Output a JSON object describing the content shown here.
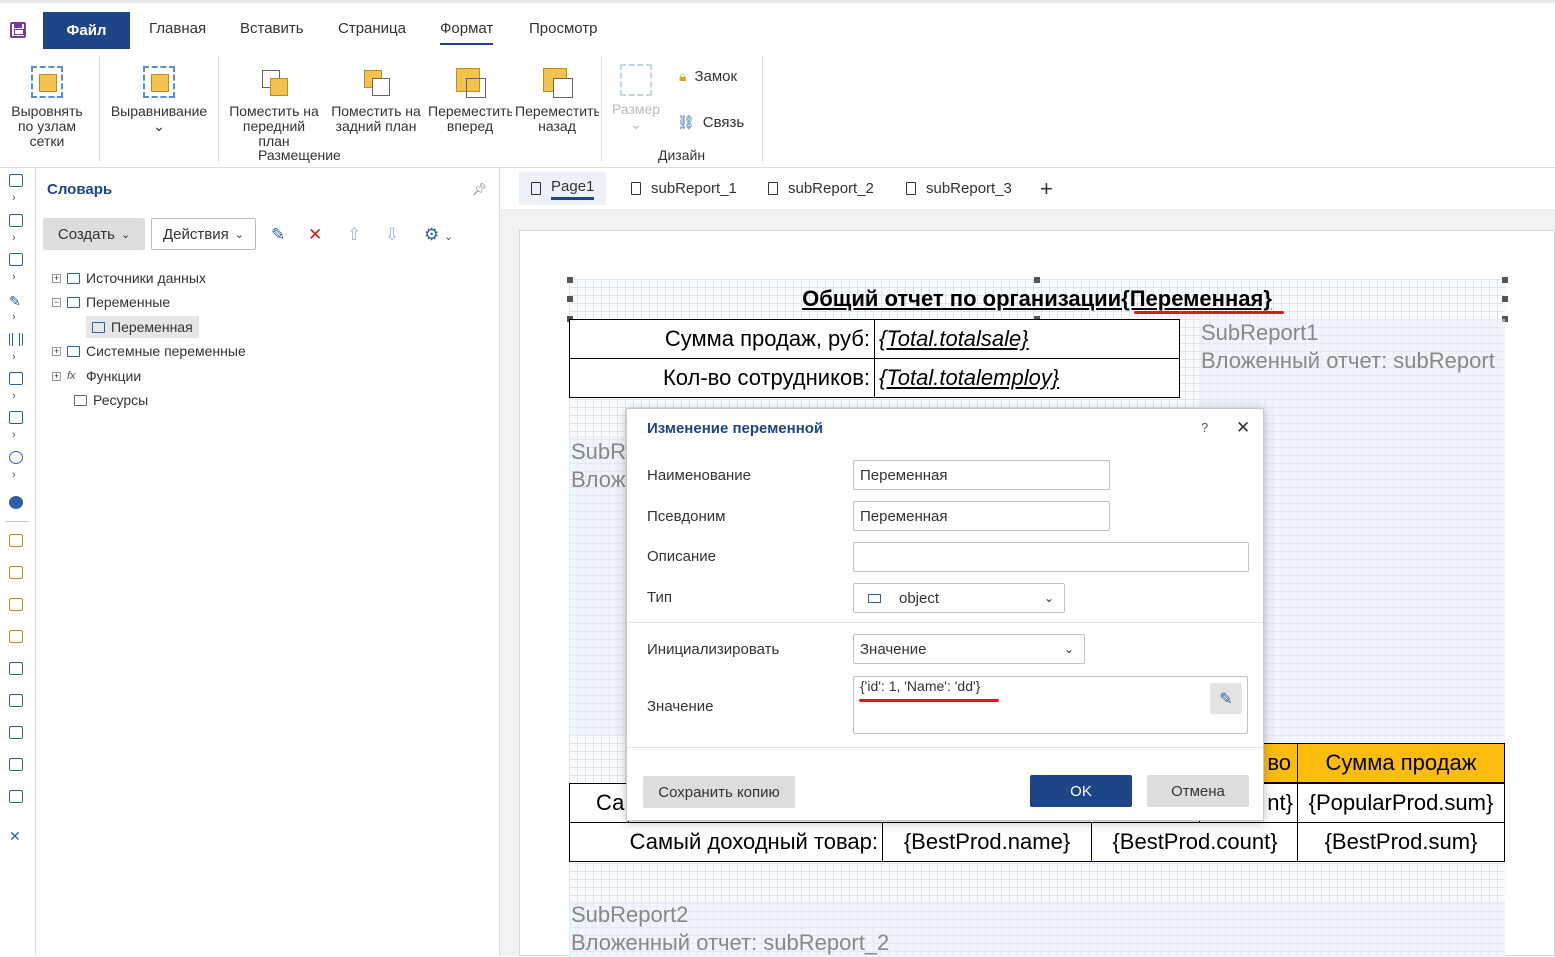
{
  "ribbon": {
    "file_tab": "Файл",
    "tabs": [
      "Главная",
      "Вставить",
      "Страница",
      "Формат",
      "Просмотр"
    ],
    "active_tab": "Формат",
    "buttons": {
      "align_grid": "Выровнять по узлам сетки",
      "alignment": "Выравнивание",
      "bring_front": "Поместить на передний план",
      "send_back": "Поместить на задний план",
      "move_forward": "Переместить вперед",
      "move_backward": "Переместить назад",
      "size": "Размер",
      "lock": "Замок",
      "link": "Связь"
    },
    "groups": {
      "placement": "Размещение",
      "design": "Дизайн"
    }
  },
  "dictionary": {
    "title": "Словарь",
    "create_button": "Создать",
    "actions_button": "Действия",
    "tree": {
      "data_sources": "Источники данных",
      "variables": "Переменные",
      "variable_item": "Переменная",
      "system_variables": "Системные переменные",
      "functions": "Функции",
      "resources": "Ресурсы"
    }
  },
  "page_tabs": [
    "Page1",
    "subReport_1",
    "subReport_2",
    "subReport_3"
  ],
  "active_page_tab": "Page1",
  "report": {
    "title": "Общий отчет по организации{Переменная}",
    "rows": [
      {
        "label": "Сумма продаж, руб:",
        "value": "{Total.totalsale}"
      },
      {
        "label": "Кол-во сотрудников:",
        "value": "{Total.totalemploy}"
      }
    ],
    "subreport1_name": "SubReport1",
    "subreport1_desc": "Вложенный отчет: subReport",
    "subreport_left_name": "SubRe",
    "subreport_left_desc": "Вложе",
    "table_header_partial": "во",
    "table_header_sum": "Сумма продаж",
    "popular_row": {
      "label_partial": "Са",
      "count_partial": "nt}",
      "sum": "{PopularProd.sum}"
    },
    "best_row": {
      "label": "Самый доходный товар:",
      "name": "{BestProd.name}",
      "count": "{BestProd.count}",
      "sum": "{BestProd.sum}"
    },
    "subreport2_name": "SubReport2",
    "subreport2_desc": "Вложенный отчет: subReport_2"
  },
  "dialog": {
    "title": "Изменение переменной",
    "help": "?",
    "close": "✕",
    "fields": {
      "name_label": "Наименование",
      "name_value": "Переменная",
      "alias_label": "Псевдоним",
      "alias_value": "Переменная",
      "description_label": "Описание",
      "description_value": "",
      "type_label": "Тип",
      "type_value": "object",
      "init_label": "Инициализировать",
      "init_value": "Значение",
      "value_label": "Значение",
      "value_value": "{'id': 1, 'Name': 'dd'}"
    },
    "save_copy": "Сохранить копию",
    "ok": "OK",
    "cancel": "Отмена"
  },
  "colors": {
    "brand": "#1d4587",
    "header_orange": "#fbbb0f",
    "annotation_red": "#d81b1b"
  }
}
